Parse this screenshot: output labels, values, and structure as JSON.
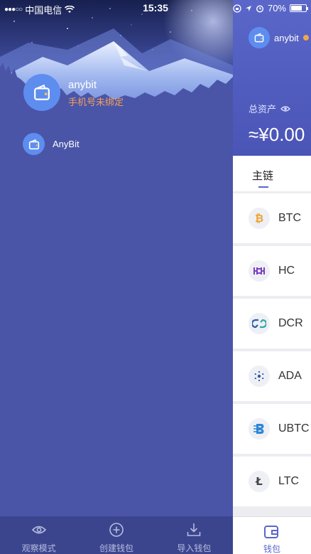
{
  "status_bar": {
    "carrier": "中国电信",
    "time": "15:35",
    "battery": "70%"
  },
  "drawer": {
    "profile": {
      "name": "anybit",
      "bind_status": "手机号未绑定"
    },
    "wallets": [
      {
        "label": "AnyBit"
      }
    ],
    "bottom_bar": [
      {
        "label": "观察模式",
        "icon": "eye-icon"
      },
      {
        "label": "创建钱包",
        "icon": "plus-circle-icon"
      },
      {
        "label": "导入钱包",
        "icon": "download-icon"
      }
    ]
  },
  "main": {
    "wallet_name": "anybit",
    "total_assets_label": "总资产",
    "total_assets_value": "≈¥0.00",
    "chain_tab": "主链",
    "coins": [
      {
        "name": "BTC",
        "icon": "bitcoin-icon",
        "color": "#f0a030"
      },
      {
        "name": "HC",
        "icon": "hcash-icon",
        "color": "#7b3fbf"
      },
      {
        "name": "DCR",
        "icon": "decred-icon",
        "color": "#2fa9a4"
      },
      {
        "name": "ADA",
        "icon": "cardano-icon",
        "color": "#2a5ca8"
      },
      {
        "name": "UBTC",
        "icon": "ubtc-icon",
        "color": "#2f86d6"
      },
      {
        "name": "LTC",
        "icon": "litecoin-icon",
        "color": "#444444"
      }
    ],
    "tabbar_label": "钱包"
  },
  "colors": {
    "drawer_bg": "#4a55a8",
    "accent": "#5a67c9",
    "warning": "#f5a05a"
  }
}
